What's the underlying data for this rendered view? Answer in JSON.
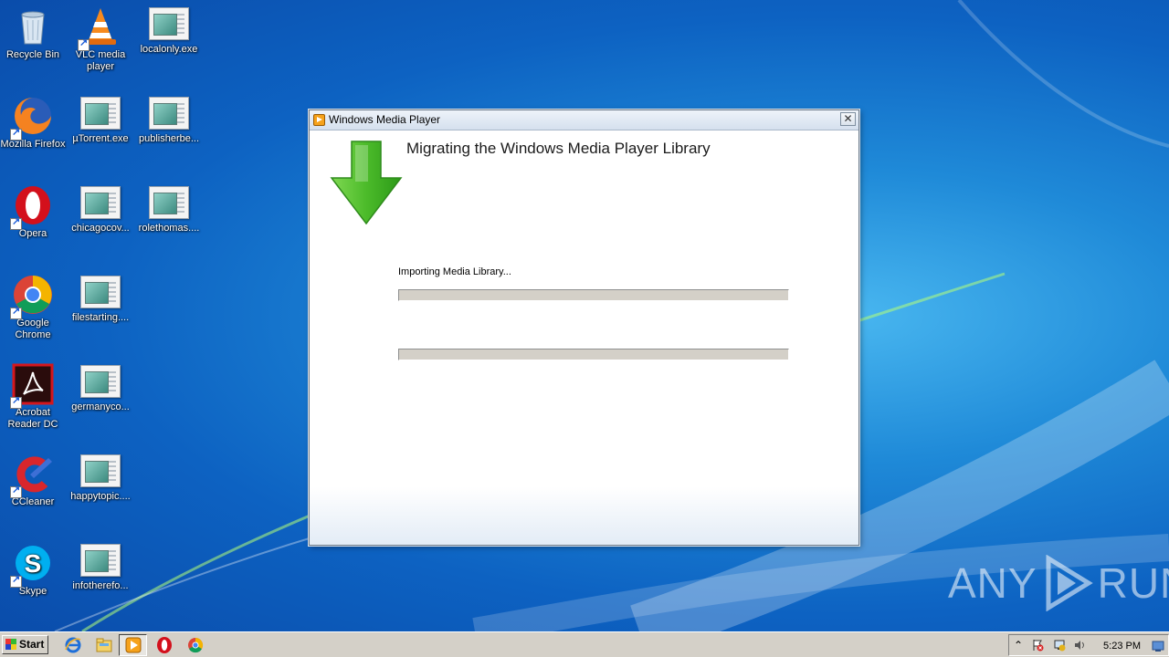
{
  "desktop": {
    "icons": [
      {
        "label": "Recycle Bin"
      },
      {
        "label": "VLC media player"
      },
      {
        "label": "localonly.exe"
      },
      {
        "label": "Mozilla Firefox"
      },
      {
        "label": "µTorrent.exe"
      },
      {
        "label": "publisherbe..."
      },
      {
        "label": "Opera"
      },
      {
        "label": "chicagocov..."
      },
      {
        "label": "rolethomas...."
      },
      {
        "label": "Google Chrome"
      },
      {
        "label": "filestarting...."
      },
      {
        "label": "Acrobat Reader DC"
      },
      {
        "label": "germanyco..."
      },
      {
        "label": "CCleaner"
      },
      {
        "label": "happytopic...."
      },
      {
        "label": "Skype"
      },
      {
        "label": "infotherefo..."
      }
    ]
  },
  "window": {
    "title": "Windows Media Player",
    "close_label": "✕",
    "heading": "Migrating the Windows Media Player Library",
    "status_text": "Importing Media Library...",
    "progress_1": 0,
    "progress_2": 0
  },
  "watermark": {
    "left": "ANY",
    "right": "RUN"
  },
  "taskbar": {
    "start_label": "Start",
    "pinned": [
      "internet-explorer-icon",
      "file-explorer-icon",
      "windows-media-player-icon",
      "opera-icon",
      "chrome-icon"
    ],
    "tray_expand": "⌃",
    "clock": "5:23 PM"
  }
}
